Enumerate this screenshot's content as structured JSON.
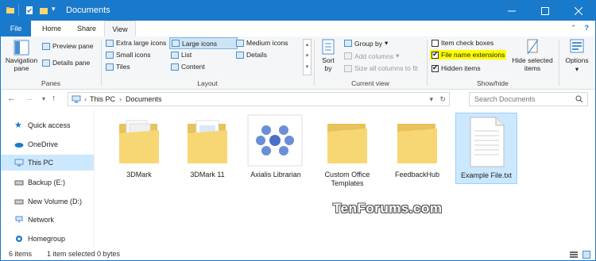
{
  "window": {
    "title": "Documents"
  },
  "tabs": [
    "File",
    "Home",
    "Share",
    "View"
  ],
  "ribbon": {
    "panes": {
      "label": "Panes",
      "navigation_pane": "Navigation pane",
      "preview_pane": "Preview pane",
      "details_pane": "Details pane"
    },
    "layout": {
      "label": "Layout",
      "items": [
        "Extra large icons",
        "Large icons",
        "Medium icons",
        "Small icons",
        "List",
        "Details",
        "Tiles",
        "Content"
      ]
    },
    "current_view": {
      "label": "Current view",
      "sort_by": "Sort by",
      "group_by": "Group by",
      "add_columns": "Add columns",
      "size_all_columns": "Size all columns to fit"
    },
    "show_hide": {
      "label": "Show/hide",
      "item_check_boxes": "Item check boxes",
      "file_name_extensions": "File name extensions",
      "hidden_items": "Hidden items",
      "hide_selected": "Hide selected items"
    },
    "options": "Options"
  },
  "address": {
    "this_pc": "This PC",
    "documents": "Documents",
    "search_placeholder": "Search Documents"
  },
  "nav_pane": [
    "Quick access",
    "OneDrive",
    "This PC",
    "Backup (E:)",
    "New Volume (D:)",
    "Network",
    "Homegroup"
  ],
  "files": [
    "3DMark",
    "3DMark 11",
    "Axialis Librarian",
    "Custom Office Templates",
    "FeedbackHub",
    "Example File.txt"
  ],
  "watermark": "TenForums.com",
  "status": {
    "items": "6 items",
    "selected": "1 item selected",
    "size": "0 bytes"
  },
  "colors": {
    "accent": "#1979ca",
    "folder": "#f7d774",
    "highlight": "#ffff00",
    "selection": "#cce8ff"
  }
}
